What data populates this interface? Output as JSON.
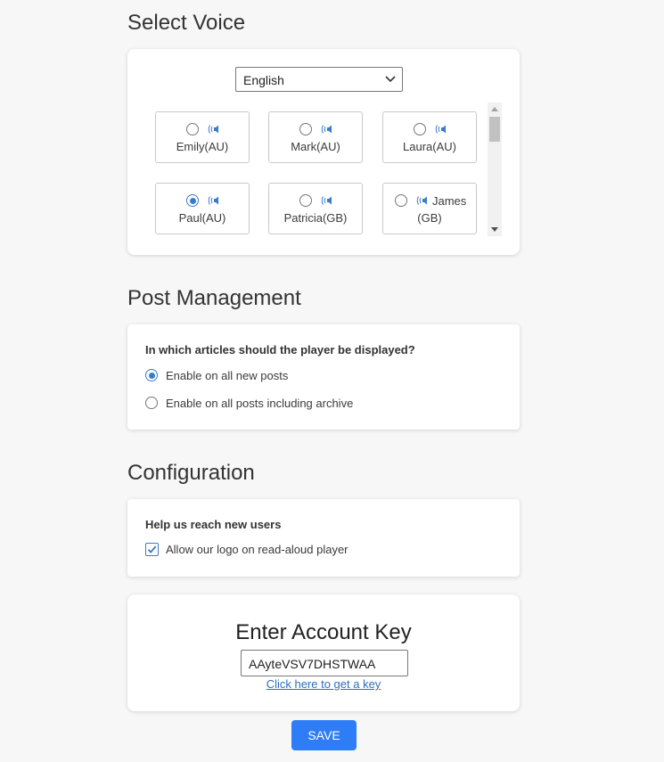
{
  "colors": {
    "accent": "#3b7cc9",
    "button": "#2f7df6",
    "link": "#2f6fbf"
  },
  "select_voice": {
    "title": "Select Voice",
    "language": "English",
    "voices": [
      {
        "name": "Emily(AU)",
        "selected": false,
        "icon": "speaker-icon"
      },
      {
        "name": "Mark(AU)",
        "selected": false,
        "icon": "speaker-icon"
      },
      {
        "name": "Laura(AU)",
        "selected": false,
        "icon": "speaker-icon"
      },
      {
        "name": "Paul(AU)",
        "selected": true,
        "icon": "speaker-icon"
      },
      {
        "name": "Patricia(GB)",
        "selected": false,
        "icon": "speaker-icon"
      },
      {
        "name_line1": "James",
        "name_line2": "(GB)",
        "selected": false,
        "icon": "speaker-icon"
      }
    ]
  },
  "post_management": {
    "title": "Post Management",
    "question": "In which articles should the player be displayed?",
    "options": [
      {
        "label": "Enable on all new posts",
        "selected": true
      },
      {
        "label": "Enable on all posts including archive",
        "selected": false
      }
    ]
  },
  "configuration": {
    "title": "Configuration",
    "question": "Help us reach new users",
    "checkbox_label": "Allow our logo on read-aloud player",
    "checked": true
  },
  "account": {
    "title": "Enter Account Key",
    "key_value": "AAyteVSV7DHSTWAA",
    "link_text": "Click here to get a key"
  },
  "save_label": "SAVE"
}
